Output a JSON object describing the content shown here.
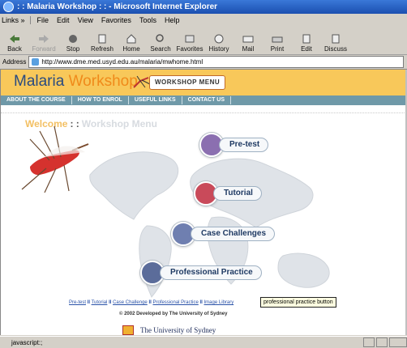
{
  "window": {
    "title": ": : Malaria Workshop : : - Microsoft Internet Explorer"
  },
  "menu": {
    "links": "Links »",
    "items": [
      "File",
      "Edit",
      "View",
      "Favorites",
      "Tools",
      "Help"
    ]
  },
  "toolbar": {
    "buttons": [
      "Back",
      "Forward",
      "Stop",
      "Refresh",
      "Home",
      "Search",
      "Favorites",
      "History",
      "Mail",
      "Print",
      "Edit",
      "Discuss"
    ]
  },
  "address": {
    "label": "Address",
    "url": "http://www.dme.med.usyd.edu.au/malaria/mwhome.html"
  },
  "site": {
    "logo_a": "Malaria",
    "logo_b": "Workshop",
    "workshop_menu": "WORKSHOP MENU",
    "nav": [
      "ABOUT THE COURSE",
      "HOW TO ENROL",
      "USEFUL LINKS",
      "CONTACT US"
    ],
    "welcome": "Welcome",
    "welcome_sep": ": :",
    "welcome_rest": "Workshop Menu",
    "choices": [
      {
        "label": "Pre-test",
        "color": "#8b6fb0"
      },
      {
        "label": "Tutorial",
        "color": "#c94a5a"
      },
      {
        "label": "Case Challenges",
        "color": "#6f7fb0"
      },
      {
        "label": "Professional Practice",
        "color": "#5b6c9a"
      }
    ],
    "tooltip": "professional practice button",
    "footer_links": [
      "Pre-test",
      "Tutorial",
      "Case Challenge",
      "Professional Practice",
      "Image Library"
    ],
    "footer_sep": "II",
    "copyright": "© 2002 Developed by The University of Sydney",
    "university": "The University of Sydney"
  },
  "status": {
    "text": "javascript:;"
  }
}
